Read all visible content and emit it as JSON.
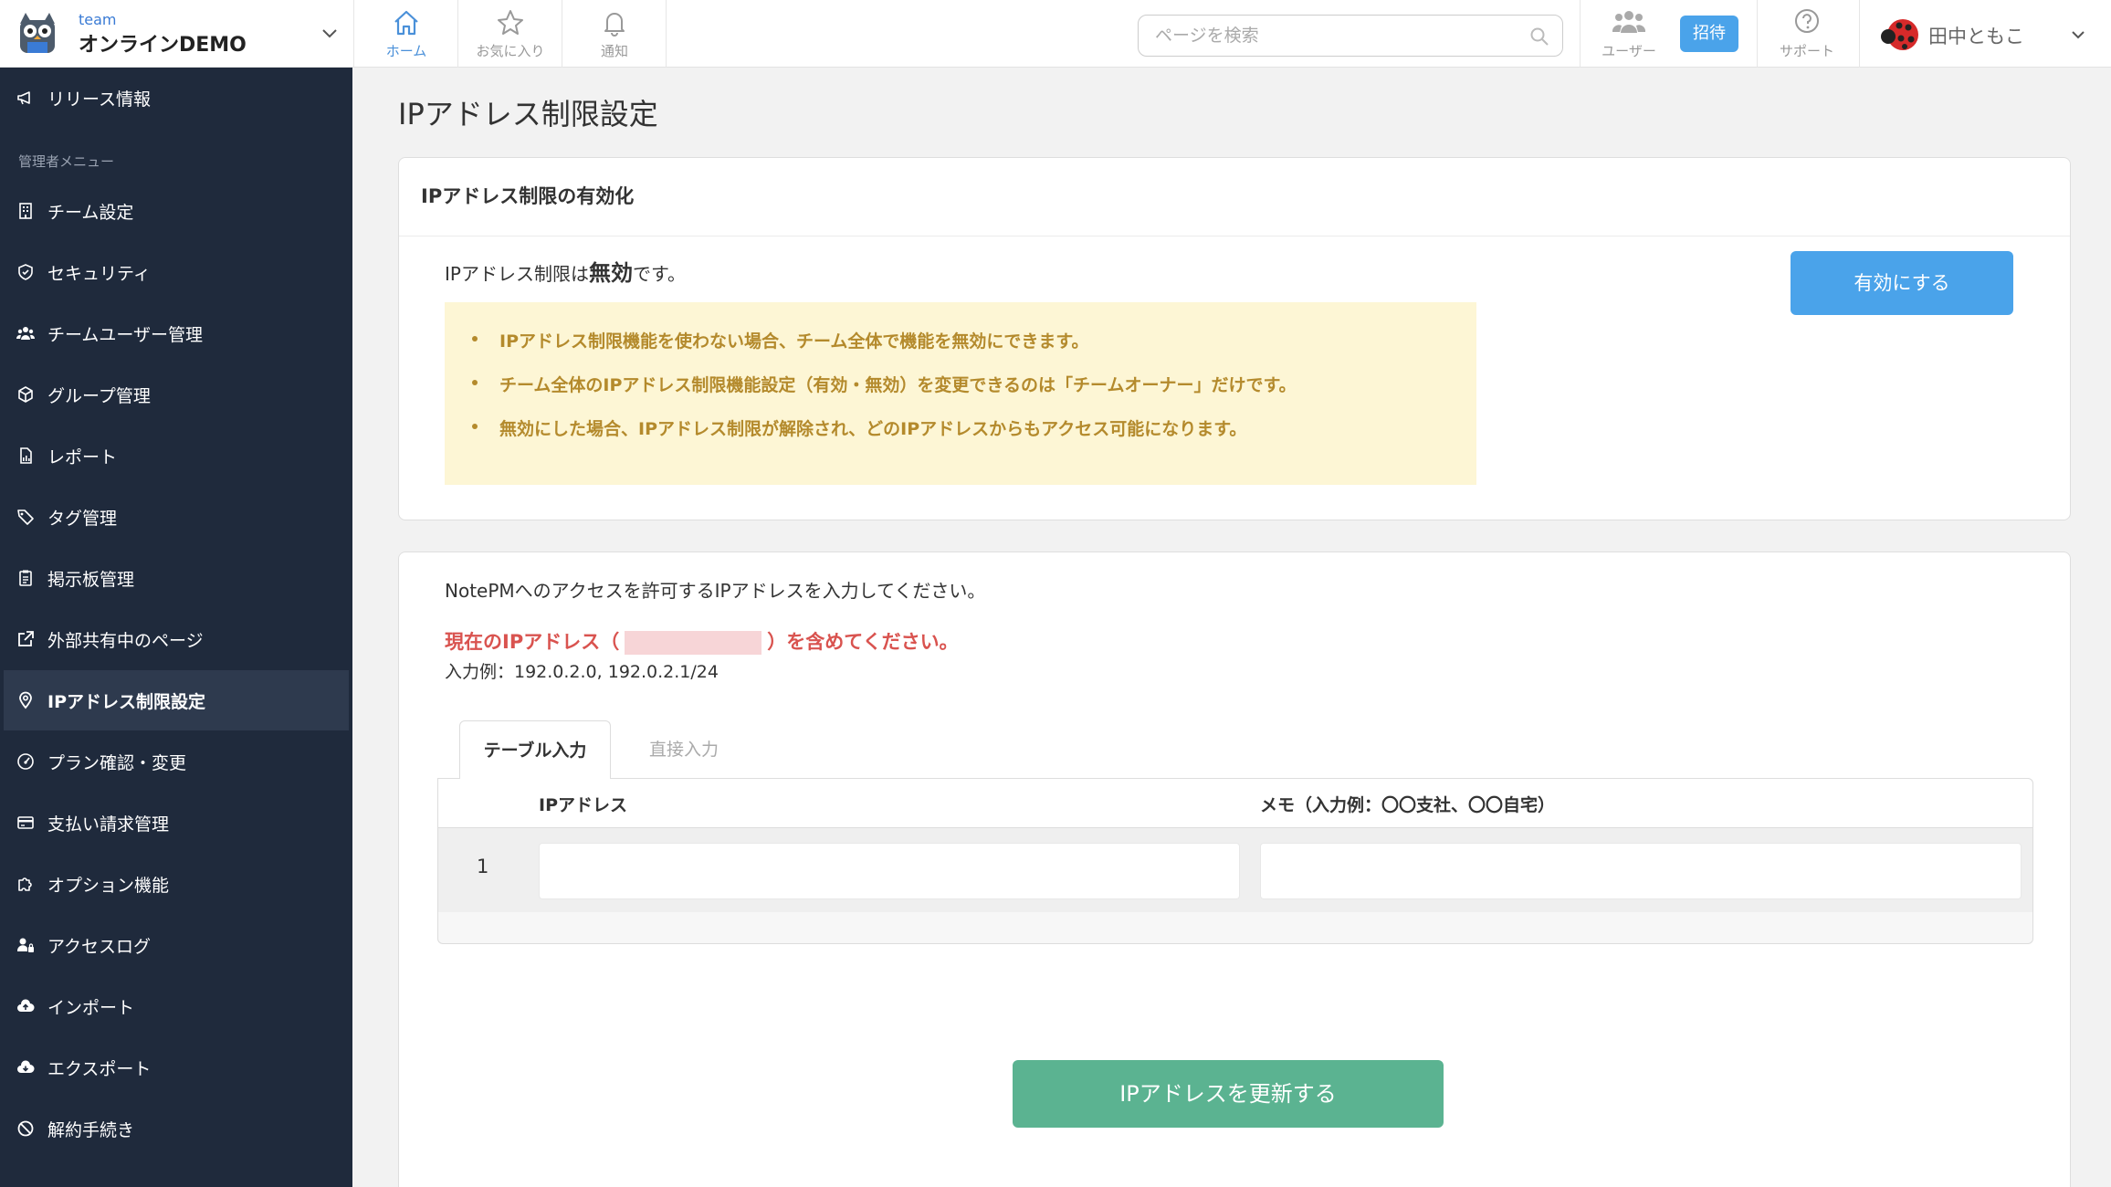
{
  "header": {
    "team_small": "team",
    "team_name": "オンラインDEMO",
    "nav": {
      "home": "ホーム",
      "favorites": "お気に入り",
      "notifications": "通知"
    },
    "search_placeholder": "ページを検索",
    "users_label": "ユーザー",
    "invite_label": "招待",
    "support_label": "サポート",
    "user_name": "田中ともこ"
  },
  "sidebar": {
    "release": "リリース情報",
    "section_label": "管理者メニュー",
    "items": [
      {
        "label": "チーム設定",
        "icon": "building-icon"
      },
      {
        "label": "セキュリティ",
        "icon": "shield-icon"
      },
      {
        "label": "チームユーザー管理",
        "icon": "users-icon"
      },
      {
        "label": "グループ管理",
        "icon": "cube-icon"
      },
      {
        "label": "レポート",
        "icon": "report-icon"
      },
      {
        "label": "タグ管理",
        "icon": "tag-icon"
      },
      {
        "label": "掲示板管理",
        "icon": "clipboard-icon"
      },
      {
        "label": "外部共有中のページ",
        "icon": "external-link-icon"
      },
      {
        "label": "IPアドレス制限設定",
        "icon": "map-pin-icon",
        "active": true
      },
      {
        "label": "プラン確認・変更",
        "icon": "gauge-icon"
      },
      {
        "label": "支払い請求管理",
        "icon": "credit-card-icon"
      },
      {
        "label": "オプション機能",
        "icon": "puzzle-icon"
      },
      {
        "label": "アクセスログ",
        "icon": "user-lock-icon"
      },
      {
        "label": "インポート",
        "icon": "cloud-upload-icon"
      },
      {
        "label": "エクスポート",
        "icon": "cloud-download-icon"
      },
      {
        "label": "解約手続き",
        "icon": "ban-icon"
      }
    ]
  },
  "main": {
    "page_title": "IPアドレス制限設定",
    "enable_card": {
      "heading": "IPアドレス制限の有効化",
      "status_prefix": "IPアドレス制限は",
      "status_value": "無効",
      "status_suffix": "です。",
      "enable_button": "有効にする",
      "notices": [
        "IPアドレス制限機能を使わない場合、チーム全体で機能を無効にできます。",
        "チーム全体のIPアドレス制限機能設定（有効・無効）を変更できるのは「チームオーナー」だけです。",
        "無効にした場合、IPアドレス制限が解除され、どのIPアドレスからもアクセス可能になります。"
      ]
    },
    "ip_card": {
      "intro": "NotePMへのアクセスを許可するIPアドレスを入力してください。",
      "warning_prefix": "現在のIPアドレス（",
      "warning_suffix": "）を含めてください。",
      "example": "入力例：192.0.2.0, 192.0.2.1/24",
      "tabs": [
        "テーブル入力",
        "直接入力"
      ],
      "columns": [
        "IPアドレス",
        "メモ（入力例：〇〇支社、〇〇自宅）"
      ],
      "rows": [
        {
          "num": "1",
          "ip": "",
          "memo": ""
        }
      ],
      "update_button": "IPアドレスを更新する"
    }
  },
  "colors": {
    "sidebar_bg": "#1f2a3c",
    "primary_blue": "#4aa3ea",
    "update_green": "#5bb391",
    "warning_red": "#d9534f",
    "notice_bg": "#fdf6d5",
    "notice_text": "#b48a2c"
  }
}
